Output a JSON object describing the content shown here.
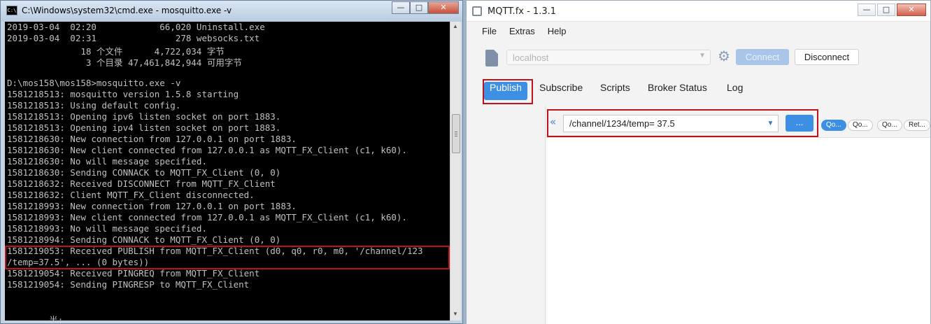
{
  "cmd": {
    "title": "C:\\Windows\\system32\\cmd.exe - mosquitto.exe  -v",
    "icon_text": "C:\\",
    "buttons": {
      "minimize": "—",
      "maximize": "□",
      "close": "✕"
    },
    "lines": [
      "2019-03-04  02:20            66,020 Uninstall.exe",
      "2019-03-04  02:31               278 websocks.txt",
      "              18 个文件      4,722,034 字节",
      "               3 个目录 47,461,842,944 可用字节",
      "",
      "D:\\mos158\\mos158>mosquitto.exe -v",
      "1581218513: mosquitto version 1.5.8 starting",
      "1581218513: Using default config.",
      "1581218513: Opening ipv6 listen socket on port 1883.",
      "1581218513: Opening ipv4 listen socket on port 1883.",
      "1581218630: New connection from 127.0.0.1 on port 1883.",
      "1581218630: New client connected from 127.0.0.1 as MQTT_FX_Client (c1, k60).",
      "1581218630: No will message specified.",
      "1581218630: Sending CONNACK to MQTT_FX_Client (0, 0)",
      "1581218632: Received DISCONNECT from MQTT_FX_Client",
      "1581218632: Client MQTT_FX_Client disconnected.",
      "1581218993: New connection from 127.0.0.1 on port 1883.",
      "1581218993: New client connected from 127.0.0.1 as MQTT_FX_Client (c1, k60).",
      "1581218993: No will message specified.",
      "1581218994: Sending CONNACK to MQTT_FX_Client (0, 0)",
      "1581219053: Received PUBLISH from MQTT_FX_Client (d0, q0, r0, m0, '/channel/123",
      "/temp=37.5', ... (0 bytes))",
      "1581219054: Received PINGREQ from MQTT_FX_Client",
      "1581219054: Sending PINGRESP to MQTT_FX_Client",
      "",
      "",
      "        半:"
    ]
  },
  "mqtt": {
    "title": "MQTT.fx - 1.3.1",
    "buttons": {
      "minimize": "—",
      "maximize": "□",
      "close": "✕"
    },
    "menu": [
      "File",
      "Extras",
      "Help"
    ],
    "broker": {
      "value": "localhost",
      "arrow": "▼"
    },
    "gear_icon": "⚙",
    "connect_label": "Connect",
    "disconnect_label": "Disconnect",
    "tabs": [
      "Publish",
      "Subscribe",
      "Scripts",
      "Broker Status",
      "Log"
    ],
    "active_tab": "Publish",
    "collapse_icon": "«",
    "topic": {
      "value": "/channel/1234/temp= 37.5",
      "arrow": "▼"
    },
    "ellipsis_label": "...",
    "qos_buttons": [
      "Qo...",
      "Qo...",
      "Qo...",
      "Ret..."
    ],
    "colors": {
      "accent": "#3c8fe3",
      "highlight": "#c0121d",
      "console_bg": "#000000"
    }
  }
}
